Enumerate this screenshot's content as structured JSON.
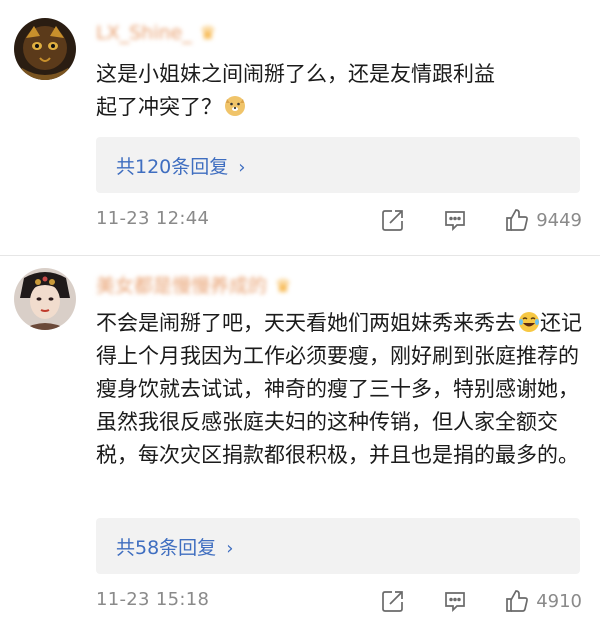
{
  "comments": [
    {
      "username": "LX_Shine_",
      "text_line1": "这是小姐妹之间闹掰了么，还是友情跟利益",
      "text_line2": "起了冲突了？",
      "reply_count_label": "共120条回复",
      "timestamp": "11-23 12:44",
      "likes": "9449",
      "emoji_icon": "doge-emoji"
    },
    {
      "username": "美女都是慢慢养成的",
      "text_pre_emoji": "不会是闹掰了吧，天天看她们两姐妹秀来秀去",
      "text_post_emoji": "还记得上个月我因为工作必须要瘦，刚好刷到张庭推荐的瘦身饮就去试试，神奇的瘦了三十多，特别感谢她，虽然我很反感张庭夫妇的这种传销，但人家全额交税，每次灾区捐款都很积极，并且也是捐的最多的。",
      "reply_count_label": "共58条回复",
      "timestamp": "11-23 15:18",
      "likes": "4910",
      "emoji_icon": "laughing-tears-emoji"
    }
  ],
  "icons": {
    "chevron": "›",
    "crown": "crown-icon",
    "share": "share-icon",
    "reply": "comment-icon",
    "like": "thumbs-up-icon"
  },
  "colors": {
    "link": "#3f6ec0",
    "meta": "#8a8a8a",
    "reply_bg": "#f2f2f2"
  }
}
